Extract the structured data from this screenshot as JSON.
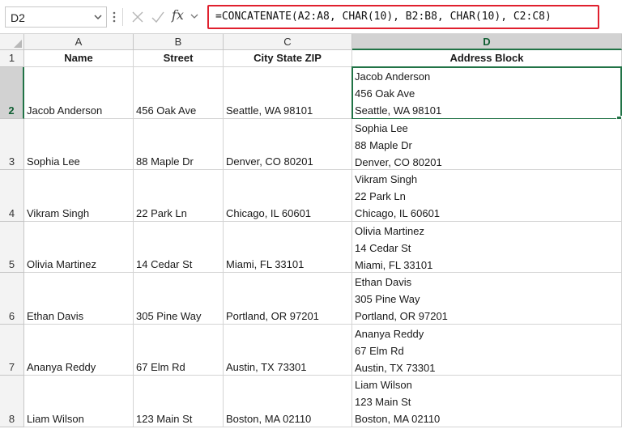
{
  "formula_bar": {
    "name_box": "D2",
    "fx_label": "fx",
    "formula": "=CONCATENATE(A2:A8, CHAR(10), B2:B8, CHAR(10), C2:C8)"
  },
  "columns": [
    "A",
    "B",
    "C",
    "D"
  ],
  "headers": {
    "row_number": "1",
    "name": "Name",
    "street": "Street",
    "city": "City State ZIP",
    "address": "Address Block"
  },
  "rows": [
    {
      "num": "2",
      "name": "Jacob Anderson",
      "street": "456 Oak Ave",
      "city": "Seattle, WA 98101",
      "address": [
        "Jacob Anderson",
        "456 Oak Ave",
        "Seattle, WA 98101"
      ]
    },
    {
      "num": "3",
      "name": "Sophia Lee",
      "street": "88 Maple Dr",
      "city": "Denver, CO 80201",
      "address": [
        "Sophia Lee",
        "88 Maple Dr",
        "Denver, CO 80201"
      ]
    },
    {
      "num": "4",
      "name": "Vikram Singh",
      "street": "22 Park Ln",
      "city": "Chicago, IL 60601",
      "address": [
        "Vikram Singh",
        "22 Park Ln",
        "Chicago, IL 60601"
      ]
    },
    {
      "num": "5",
      "name": "Olivia Martinez",
      "street": "14 Cedar St",
      "city": "Miami, FL 33101",
      "address": [
        "Olivia Martinez",
        "14 Cedar St",
        "Miami, FL 33101"
      ]
    },
    {
      "num": "6",
      "name": "Ethan Davis",
      "street": "305 Pine Way",
      "city": "Portland, OR 97201",
      "address": [
        "Ethan Davis",
        "305 Pine Way",
        "Portland, OR 97201"
      ]
    },
    {
      "num": "7",
      "name": "Ananya Reddy",
      "street": "67 Elm Rd",
      "city": "Austin, TX 73301",
      "address": [
        "Ananya Reddy",
        "67 Elm Rd",
        "Austin, TX 73301"
      ]
    },
    {
      "num": "8",
      "name": "Liam Wilson",
      "street": "123 Main St",
      "city": "Boston, MA 02110",
      "address": [
        "Liam Wilson",
        "123 Main St",
        "Boston, MA 02110"
      ]
    }
  ],
  "colors": {
    "selection": "#217346",
    "formula_highlight": "#e0202e"
  }
}
